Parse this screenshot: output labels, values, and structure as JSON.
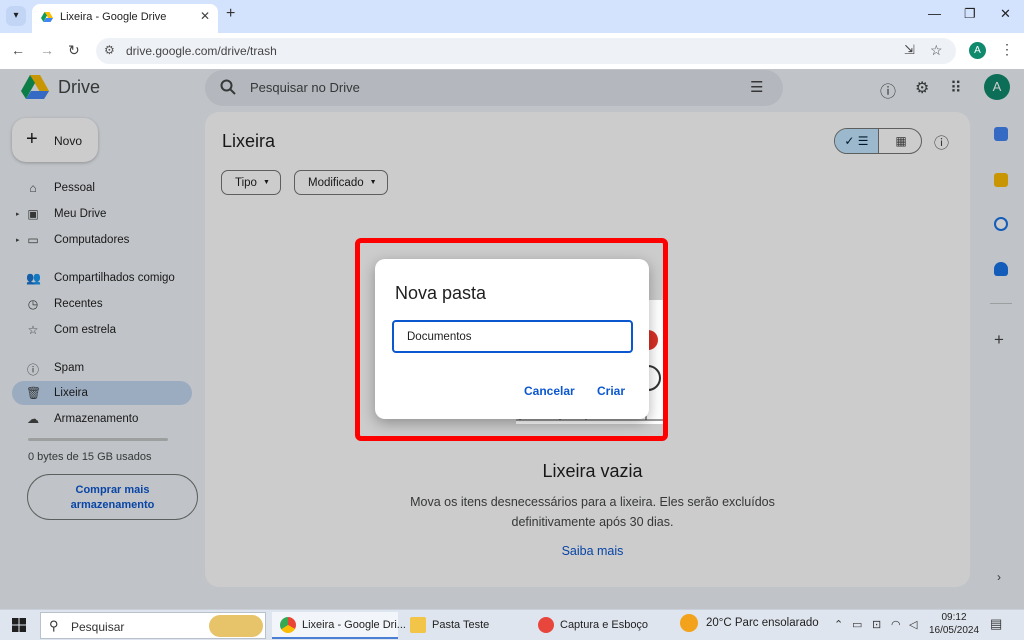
{
  "browser": {
    "tab_title": "Lixeira - Google Drive",
    "url": "drive.google.com/drive/trash",
    "profile_initial": "A"
  },
  "drive": {
    "brand": "Drive",
    "search_placeholder": "Pesquisar no Drive",
    "avatar_initial": "A"
  },
  "sidebar": {
    "new_label": "Novo",
    "items": [
      {
        "label": "Pessoal",
        "icon": "home-icon"
      },
      {
        "label": "Meu Drive",
        "icon": "drive-icon"
      },
      {
        "label": "Computadores",
        "icon": "computer-icon"
      },
      {
        "label": "Compartilhados comigo",
        "icon": "people-icon"
      },
      {
        "label": "Recentes",
        "icon": "clock-icon"
      },
      {
        "label": "Com estrela",
        "icon": "star-icon"
      },
      {
        "label": "Spam",
        "icon": "spam-icon"
      },
      {
        "label": "Lixeira",
        "icon": "trash-icon"
      },
      {
        "label": "Armazenamento",
        "icon": "cloud-icon"
      }
    ],
    "storage_text": "0 bytes de 15 GB usados",
    "storage_used_fraction": 0,
    "buy_line1": "Comprar mais",
    "buy_line2": "armazenamento"
  },
  "main": {
    "title": "Lixeira",
    "filters": [
      "Tipo",
      "Modificado"
    ],
    "empty_title": "Lixeira vazia",
    "empty_desc_1": "Mova os itens desnecessários para a lixeira. Eles serão excluídos",
    "empty_desc_2": "definitivamente após 30 dias.",
    "learn_more": "Saiba mais"
  },
  "dialog": {
    "title": "Nova pasta",
    "input_value": "Documentos",
    "cancel": "Cancelar",
    "create": "Criar"
  },
  "taskbar": {
    "search_placeholder": "Pesquisar",
    "apps": [
      "Lixeira - Google Dri...",
      "Pasta Teste",
      "Captura e Esboço"
    ],
    "weather": "20°C  Parc ensolarado",
    "time": "09:12",
    "date": "16/05/2024"
  },
  "colors": {
    "accent": "#0b57d0",
    "highlight_frame": "#ff0000",
    "active_nav": "#c2d7f0"
  }
}
